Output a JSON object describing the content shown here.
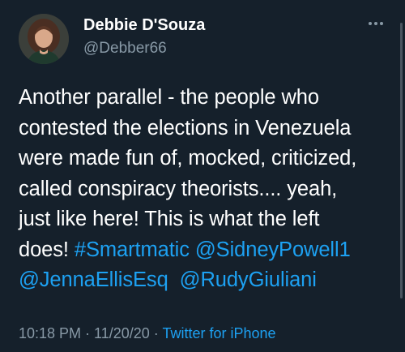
{
  "author": {
    "display_name": "Debbie D'Souza",
    "handle": "@Debber66"
  },
  "menu": {
    "icon": "more-horizontal-icon"
  },
  "tweet": {
    "line1": "Another parallel - the people who",
    "line2": "contested the elections in Venezuela",
    "line3": "were made fun of, mocked, criticized,",
    "line4": "called conspiracy theorists.... yeah,",
    "line5": "just like here! This is what the left",
    "line6_text": "does! ",
    "hashtag": "#Smartmatic",
    "mention1": "@SidneyPowell1",
    "mention2": "@JennaEllisEsq",
    "mention3": "@RudyGiuliani"
  },
  "meta": {
    "time": "10:18 PM",
    "separator1": " · ",
    "date": "11/20/20",
    "separator2": " · ",
    "source": "Twitter for iPhone"
  },
  "colors": {
    "background": "#15202b",
    "text": "#ffffff",
    "secondary": "#8899a6",
    "accent": "#1da1f2"
  }
}
